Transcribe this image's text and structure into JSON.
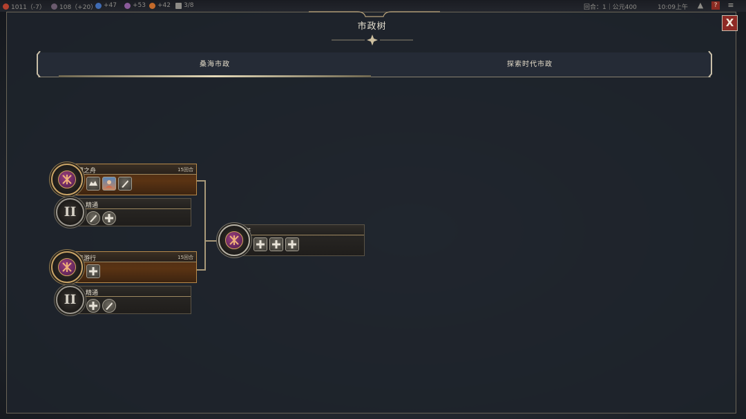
{
  "topbar": {
    "resources": [
      {
        "icon": "gold-icon",
        "color": "#b3402e",
        "text": "1011（-7）"
      },
      {
        "icon": "influence-icon",
        "color": "#6a5a6e",
        "text": "108（+20）"
      },
      {
        "icon": "science-icon",
        "color": "#3f6bb3",
        "text": "+47"
      },
      {
        "icon": "culture-icon",
        "color": "#8a5a9a",
        "text": "+53"
      },
      {
        "icon": "happiness-icon",
        "color": "#c46a2a",
        "text": "+42"
      },
      {
        "icon": "settlement-icon",
        "color": "#8d8b86",
        "text": "3/8"
      }
    ],
    "turn_label": "回合：1｜公元400",
    "time": "10:09上午"
  },
  "window": {
    "title": "市政树",
    "close_label": "X"
  },
  "tabs": [
    {
      "label": "桑海市政",
      "active": true
    },
    {
      "label": "探索时代市政",
      "active": false
    }
  ],
  "nodes": {
    "desert_ship": {
      "name": "沙漠之舟",
      "turns": "15回合",
      "icons": [
        "caravan-icon",
        "portrait-icon",
        "quill-icon"
      ]
    },
    "desert_ship_mastery": {
      "name": "精通",
      "icons": [
        "quill-icon",
        "plus-icon"
      ]
    },
    "gathering_procession": {
      "name": "聚集游行",
      "turns": "15回合",
      "icons": [
        "plus-icon"
      ]
    },
    "gathering_mastery": {
      "name": "精通",
      "icons": [
        "plus-icon",
        "quill-icon"
      ]
    },
    "kanta": {
      "name": "坎塔",
      "icons": [
        "plus-icon",
        "plus-icon",
        "plus-icon"
      ]
    }
  },
  "mastery_numeral": "II"
}
